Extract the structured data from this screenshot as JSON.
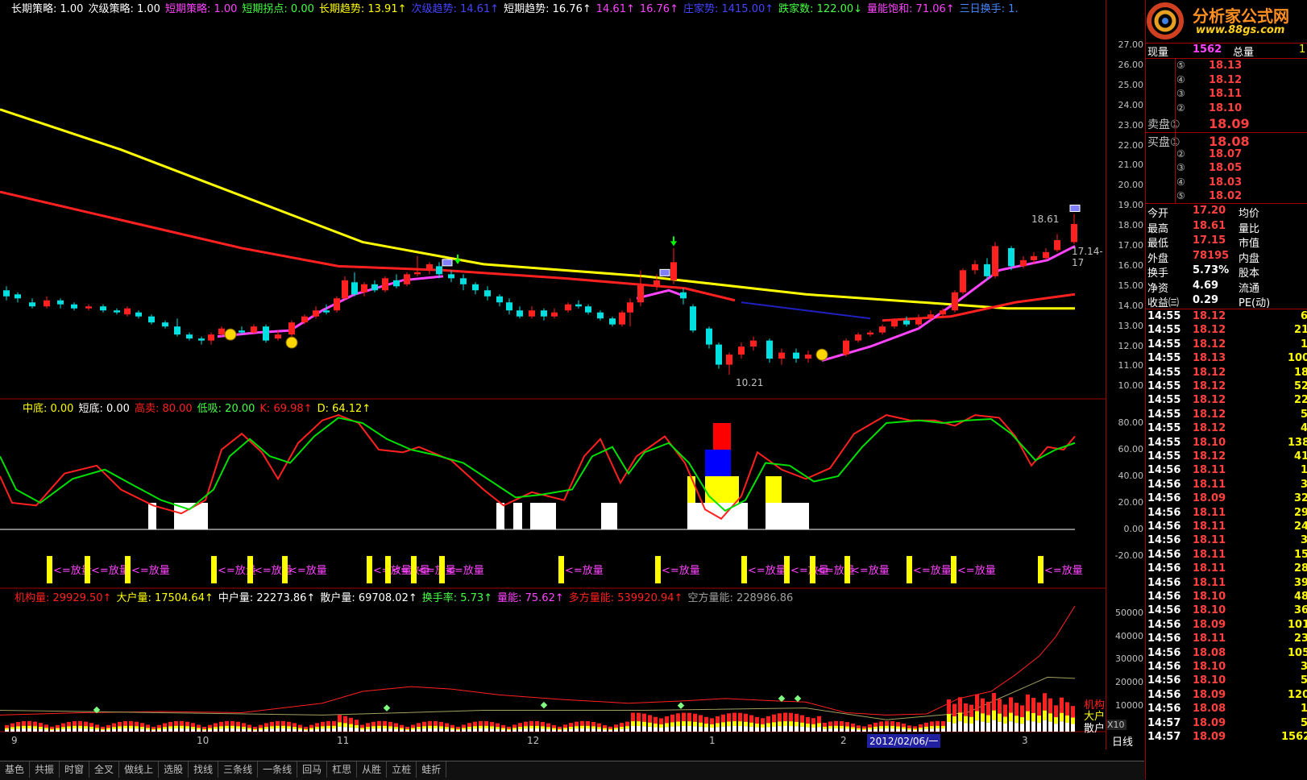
{
  "header_main": [
    {
      "text": "长期策略: 1.00",
      "color": "#ffffff"
    },
    {
      "text": "次级策略: 1.00",
      "color": "#ffffff"
    },
    {
      "text": "短期策略: 1.00",
      "color": "#ff44ff"
    },
    {
      "text": "短期拐点: 0.00",
      "color": "#44ff44"
    },
    {
      "text": "长期趋势: 13.91↑",
      "color": "#ffff00"
    },
    {
      "text": "次级趋势: 14.61↑",
      "color": "#4444ff"
    },
    {
      "text": "短期趋势: 16.76↑",
      "color": "#ffffff"
    },
    {
      "text": "14.61↑",
      "color": "#ff44ff"
    },
    {
      "text": "16.76↑",
      "color": "#ff44ff"
    },
    {
      "text": "庄家势: 1415.00↑",
      "color": "#4444ff"
    },
    {
      "text": "跌家数: 122.00↓",
      "color": "#44ff44"
    },
    {
      "text": "量能饱和: 71.06↑",
      "color": "#ff44ff"
    },
    {
      "text": "三日换手: 1.",
      "color": "#4488ff"
    }
  ],
  "header_mid": [
    {
      "text": "中底: 0.00",
      "color": "#ffff00"
    },
    {
      "text": "短底: 0.00",
      "color": "#ffffff"
    },
    {
      "text": "高卖: 80.00",
      "color": "#ff2020"
    },
    {
      "text": "低吸: 20.00",
      "color": "#44ff44"
    },
    {
      "text": "K: 69.98↑",
      "color": "#ff2020"
    },
    {
      "text": "D: 64.12↑",
      "color": "#ffff00"
    }
  ],
  "header_vol": [
    {
      "text": "机构量: 29929.50↑",
      "color": "#ff2020"
    },
    {
      "text": "大户量: 17504.64↑",
      "color": "#ffff00"
    },
    {
      "text": "中户量: 22273.86↑",
      "color": "#ffffff"
    },
    {
      "text": "散户量: 69708.02↑",
      "color": "#ffffff"
    },
    {
      "text": "换手率: 5.73↑",
      "color": "#44ff44"
    },
    {
      "text": "量能: 75.62↑",
      "color": "#ff44ff"
    },
    {
      "text": "多方量能: 539920.94↑",
      "color": "#ff2020"
    },
    {
      "text": "空方量能: 228986.86",
      "color": "#a0a0a0"
    }
  ],
  "fangliang_label": "<=放量",
  "price_labels": {
    "high": "18.61",
    "low": "10.21",
    "right": "17.14-17"
  },
  "vol_side_labels": [
    "机构",
    "大户",
    "散户",
    "X10"
  ],
  "x_labels": [
    "9",
    "10",
    "11",
    "12",
    "1",
    "2",
    "3"
  ],
  "date_cursor": "2012/02/06/一",
  "period_label": "日线",
  "price_ticks": [
    "27.00",
    "26.00",
    "25.00",
    "24.00",
    "23.00",
    "22.00",
    "21.00",
    "20.00",
    "19.00",
    "18.00",
    "17.00",
    "16.00",
    "15.00",
    "14.00",
    "13.00",
    "12.00",
    "11.00",
    "10.00"
  ],
  "kdj_ticks": [
    "80.00",
    "60.00",
    "40.00",
    "20.00",
    "0.00",
    "-20.00"
  ],
  "vol_ticks": [
    "50000",
    "40000",
    "30000",
    "20000",
    "10000"
  ],
  "tabs": [
    "基色",
    "共振",
    "时窗",
    "全叉",
    "做线上",
    "选股",
    "找线",
    "三条线",
    "一条线",
    "回马",
    "杠思",
    "从胜",
    "立桩",
    "蛙折"
  ],
  "logo": {
    "text": "分析家公式网",
    "url": "www.88gs.com"
  },
  "quote": {
    "xianliang_label": "现量",
    "xianliang": "1562",
    "zongliang_label": "总量",
    "zongliang": "1",
    "sell": [
      {
        "n": "⑤",
        "p": "18.13"
      },
      {
        "n": "④",
        "p": "18.12"
      },
      {
        "n": "③",
        "p": "18.11"
      },
      {
        "n": "②",
        "p": "18.10"
      },
      {
        "n": "卖盘①",
        "p": "18.09"
      }
    ],
    "buy": [
      {
        "n": "买盘①",
        "p": "18.08"
      },
      {
        "n": "②",
        "p": "18.07"
      },
      {
        "n": "③",
        "p": "18.05"
      },
      {
        "n": "④",
        "p": "18.03"
      },
      {
        "n": "⑤",
        "p": "18.02"
      }
    ],
    "stats": [
      {
        "a": "今开",
        "v": "17.20",
        "b": "均价",
        "c": "#ff4040"
      },
      {
        "a": "最高",
        "v": "18.61",
        "b": "量比",
        "c": "#ff4040"
      },
      {
        "a": "最低",
        "v": "17.15",
        "b": "市值",
        "c": "#ff4040"
      },
      {
        "a": "外盘",
        "v": "78195",
        "b": "内盘",
        "c": "#ff4040"
      },
      {
        "a": "换手",
        "v": "5.73%",
        "b": "股本",
        "c": "#ffffff"
      },
      {
        "a": "净资",
        "v": "4.69",
        "b": "流通",
        "c": "#ffffff"
      },
      {
        "a": "收益㈢",
        "v": "0.29",
        "b": "PE(动)",
        "c": "#ffffff"
      }
    ],
    "ticks": [
      [
        "14:55",
        "18.12",
        "6"
      ],
      [
        "14:55",
        "18.12",
        "21"
      ],
      [
        "14:55",
        "18.12",
        "1"
      ],
      [
        "14:55",
        "18.13",
        "100"
      ],
      [
        "14:55",
        "18.12",
        "18"
      ],
      [
        "14:55",
        "18.12",
        "52"
      ],
      [
        "14:55",
        "18.12",
        "22"
      ],
      [
        "14:55",
        "18.12",
        "5"
      ],
      [
        "14:55",
        "18.12",
        "4"
      ],
      [
        "14:55",
        "18.10",
        "138"
      ],
      [
        "14:55",
        "18.12",
        "41"
      ],
      [
        "14:56",
        "18.11",
        "1"
      ],
      [
        "14:56",
        "18.11",
        "3"
      ],
      [
        "14:56",
        "18.09",
        "32"
      ],
      [
        "14:56",
        "18.11",
        "29"
      ],
      [
        "14:56",
        "18.11",
        "24"
      ],
      [
        "14:56",
        "18.11",
        "3"
      ],
      [
        "14:56",
        "18.11",
        "15"
      ],
      [
        "14:56",
        "18.11",
        "28"
      ],
      [
        "14:56",
        "18.11",
        "39"
      ],
      [
        "14:56",
        "18.10",
        "48"
      ],
      [
        "14:56",
        "18.10",
        "36"
      ],
      [
        "14:56",
        "18.09",
        "101"
      ],
      [
        "14:56",
        "18.11",
        "23"
      ],
      [
        "14:56",
        "18.08",
        "105"
      ],
      [
        "14:56",
        "18.10",
        "3"
      ],
      [
        "14:56",
        "18.10",
        "5"
      ],
      [
        "14:56",
        "18.09",
        "120"
      ],
      [
        "14:56",
        "18.08",
        "1"
      ],
      [
        "14:57",
        "18.09",
        "5"
      ],
      [
        "14:57",
        "18.09",
        "1562"
      ]
    ]
  }
}
